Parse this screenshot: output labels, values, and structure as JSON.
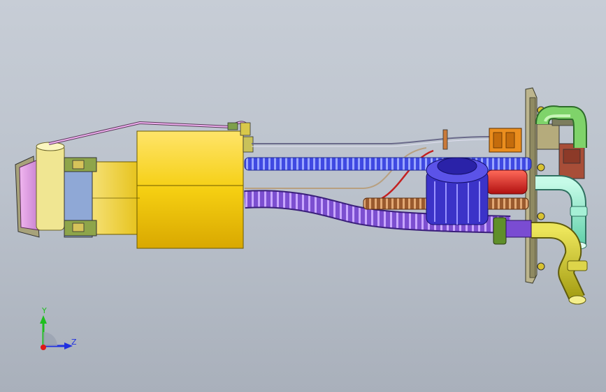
{
  "viewport": {
    "background_top": "#c7cdd6",
    "background_bottom": "#a9b0bb"
  },
  "model": {
    "name": "fuel-pump-module-assembly",
    "colors": {
      "yellow_housing": "#f7d21a",
      "blue_hose": "#3a43d8",
      "purple_hose": "#8a5ad8",
      "brown_hose": "#b0703a",
      "red_line": "#d42020",
      "cyan_pipe": "#86e6c8",
      "olive_pipe": "#c9c225",
      "flange": "#b7b08a",
      "connector_orange": "#e58a1c",
      "connector_brown": "#a54d36",
      "pink_wire": "#e6a6e0",
      "filter_violet": "#c890e6",
      "green_clip": "#7fa34a",
      "cap_blue": "#3630c0"
    }
  },
  "triad": {
    "y_label": "Y",
    "z_label": "Z",
    "y_color": "#1fbf1f",
    "z_color": "#2030e0",
    "x_color": "#e01818"
  }
}
